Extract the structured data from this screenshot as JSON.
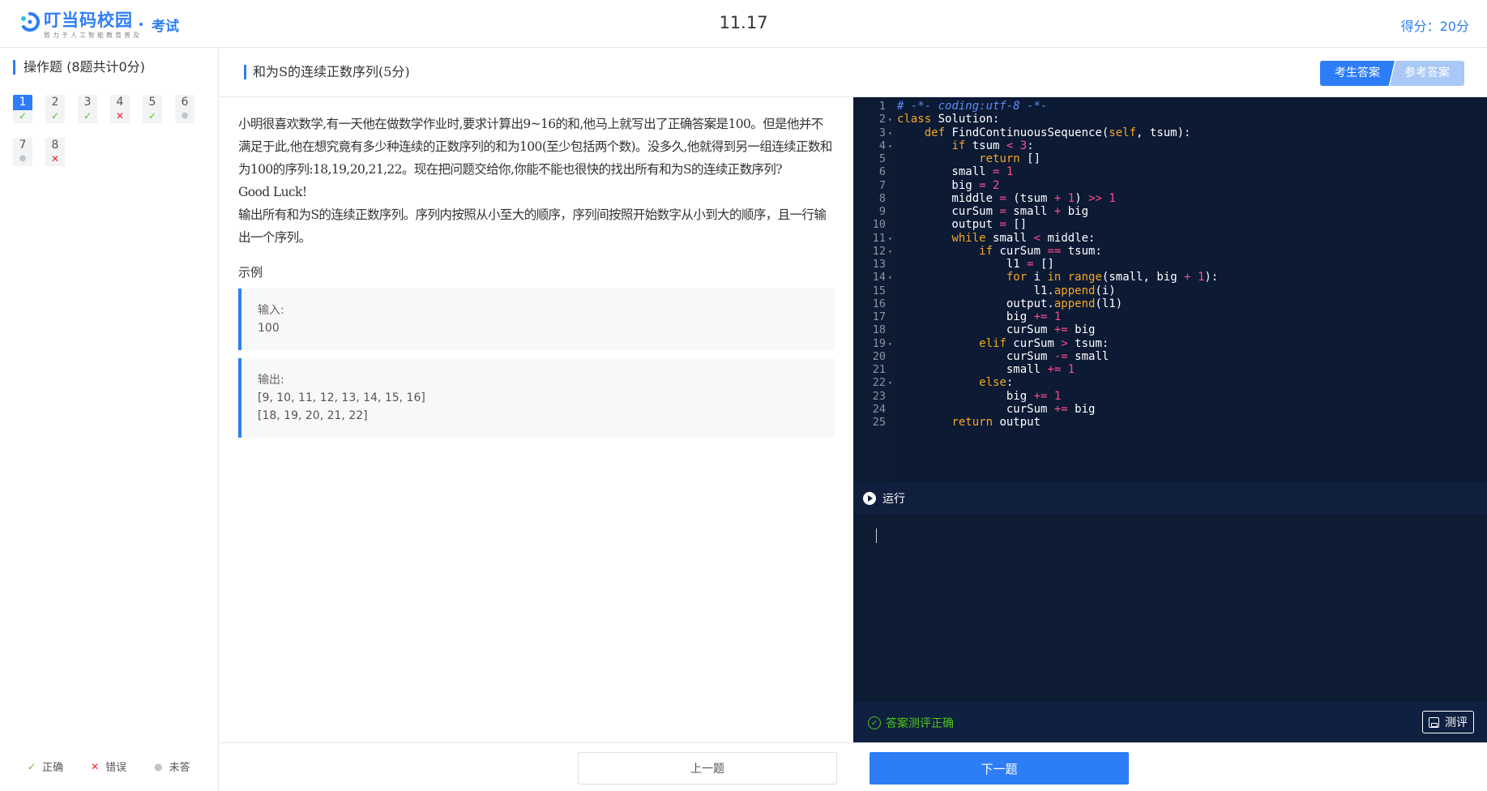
{
  "header": {
    "logo_name": "叮当码校园",
    "logo_slogan": "致力于人工智能教育普及",
    "exam_label": "考试",
    "exam_title": "11.17",
    "score_text": "得分：20分"
  },
  "sidebar": {
    "section_title": "操作题 (8题共计0分)",
    "questions": [
      {
        "num": "1",
        "status": "correct",
        "active": true
      },
      {
        "num": "2",
        "status": "correct",
        "active": false
      },
      {
        "num": "3",
        "status": "correct",
        "active": false
      },
      {
        "num": "4",
        "status": "wrong",
        "active": false
      },
      {
        "num": "5",
        "status": "correct",
        "active": false
      },
      {
        "num": "6",
        "status": "unanswered",
        "active": false
      },
      {
        "num": "7",
        "status": "unanswered",
        "active": false
      },
      {
        "num": "8",
        "status": "wrong",
        "active": false
      }
    ],
    "legend": {
      "correct": "正确",
      "wrong": "错误",
      "unanswered": "未答"
    }
  },
  "question": {
    "title": "和为S的连续正数序列(5分)",
    "tab_student": "考生答案",
    "tab_reference": "参考答案",
    "description": [
      "小明很喜欢数学,有一天他在做数学作业时,要求计算出9~16的和,他马上就写出了正确答案是100。但是他并不满足于此,他在想究竟有多少种连续的正数序列的和为100(至少包括两个数)。没多久,他就得到另一组连续正数和为100的序列:18,19,20,21,22。现在把问题交给你,你能不能也很快的找出所有和为S的连续正数序列?",
      "Good Luck!",
      "输出所有和为S的连续正数序列。序列内按照从小至大的顺序，序列间按照开始数字从小到大的顺序，且一行输出一个序列。"
    ],
    "example_label": "示例",
    "example_input_label": "输入:",
    "example_input": "100",
    "example_output_label": "输出:",
    "example_output": [
      "[9, 10, 11, 12, 13, 14, 15, 16]",
      "[18, 19, 20, 21, 22]"
    ]
  },
  "editor": {
    "lines": [
      {
        "n": "1",
        "fold": false
      },
      {
        "n": "2",
        "fold": true
      },
      {
        "n": "3",
        "fold": true
      },
      {
        "n": "4",
        "fold": true
      },
      {
        "n": "5",
        "fold": false
      },
      {
        "n": "6",
        "fold": false
      },
      {
        "n": "7",
        "fold": false
      },
      {
        "n": "8",
        "fold": false
      },
      {
        "n": "9",
        "fold": false
      },
      {
        "n": "10",
        "fold": false
      },
      {
        "n": "11",
        "fold": true
      },
      {
        "n": "12",
        "fold": true
      },
      {
        "n": "13",
        "fold": false
      },
      {
        "n": "14",
        "fold": true
      },
      {
        "n": "15",
        "fold": false
      },
      {
        "n": "16",
        "fold": false
      },
      {
        "n": "17",
        "fold": false
      },
      {
        "n": "18",
        "fold": false
      },
      {
        "n": "19",
        "fold": true
      },
      {
        "n": "20",
        "fold": false
      },
      {
        "n": "21",
        "fold": false
      },
      {
        "n": "22",
        "fold": true
      },
      {
        "n": "23",
        "fold": false
      },
      {
        "n": "24",
        "fold": false
      },
      {
        "n": "25",
        "fold": false
      }
    ],
    "code": [
      [
        [
          "c-comment",
          "# -*- coding:utf-8 -*-"
        ]
      ],
      [
        [
          "c-kw",
          "class"
        ],
        [
          "c-txt",
          " Solution:"
        ]
      ],
      [
        [
          "c-txt",
          "    "
        ],
        [
          "c-kw",
          "def"
        ],
        [
          "c-fn",
          " FindContinuousSequence("
        ],
        [
          "c-self",
          "self"
        ],
        [
          "c-txt",
          ", tsum):"
        ]
      ],
      [
        [
          "c-txt",
          "        "
        ],
        [
          "c-kw",
          "if"
        ],
        [
          "c-txt",
          " tsum "
        ],
        [
          "c-op",
          "<"
        ],
        [
          "c-txt",
          " "
        ],
        [
          "c-num",
          "3"
        ],
        [
          "c-txt",
          ":"
        ]
      ],
      [
        [
          "c-txt",
          "            "
        ],
        [
          "c-kw",
          "return"
        ],
        [
          "c-txt",
          " []"
        ]
      ],
      [
        [
          "c-txt",
          "        small "
        ],
        [
          "c-op",
          "="
        ],
        [
          "c-txt",
          " "
        ],
        [
          "c-num",
          "1"
        ]
      ],
      [
        [
          "c-txt",
          "        big "
        ],
        [
          "c-op",
          "="
        ],
        [
          "c-txt",
          " "
        ],
        [
          "c-num",
          "2"
        ]
      ],
      [
        [
          "c-txt",
          "        middle "
        ],
        [
          "c-op",
          "="
        ],
        [
          "c-txt",
          " (tsum "
        ],
        [
          "c-op",
          "+"
        ],
        [
          "c-txt",
          " "
        ],
        [
          "c-num",
          "1"
        ],
        [
          "c-txt",
          ") "
        ],
        [
          "c-op",
          ">>"
        ],
        [
          "c-txt",
          " "
        ],
        [
          "c-num",
          "1"
        ]
      ],
      [
        [
          "c-txt",
          "        curSum "
        ],
        [
          "c-op",
          "="
        ],
        [
          "c-txt",
          " small "
        ],
        [
          "c-op",
          "+"
        ],
        [
          "c-txt",
          " big"
        ]
      ],
      [
        [
          "c-txt",
          "        output "
        ],
        [
          "c-op",
          "="
        ],
        [
          "c-txt",
          " []"
        ]
      ],
      [
        [
          "c-txt",
          "        "
        ],
        [
          "c-kw",
          "while"
        ],
        [
          "c-txt",
          " small "
        ],
        [
          "c-op",
          "<"
        ],
        [
          "c-txt",
          " middle:"
        ]
      ],
      [
        [
          "c-txt",
          "            "
        ],
        [
          "c-kw",
          "if"
        ],
        [
          "c-txt",
          " curSum "
        ],
        [
          "c-op",
          "=="
        ],
        [
          "c-txt",
          " tsum:"
        ]
      ],
      [
        [
          "c-txt",
          "                l1 "
        ],
        [
          "c-op",
          "="
        ],
        [
          "c-txt",
          " []"
        ]
      ],
      [
        [
          "c-txt",
          "                "
        ],
        [
          "c-kw",
          "for"
        ],
        [
          "c-txt",
          " i "
        ],
        [
          "c-kw",
          "in"
        ],
        [
          "c-txt",
          " "
        ],
        [
          "c-kw",
          "range"
        ],
        [
          "c-txt",
          "(small, big "
        ],
        [
          "c-op",
          "+"
        ],
        [
          "c-txt",
          " "
        ],
        [
          "c-num",
          "1"
        ],
        [
          "c-txt",
          "):"
        ]
      ],
      [
        [
          "c-txt",
          "                    l1."
        ],
        [
          "c-kw",
          "append"
        ],
        [
          "c-txt",
          "(i)"
        ]
      ],
      [
        [
          "c-txt",
          "                output."
        ],
        [
          "c-kw",
          "append"
        ],
        [
          "c-txt",
          "(l1)"
        ]
      ],
      [
        [
          "c-txt",
          "                big "
        ],
        [
          "c-op",
          "+="
        ],
        [
          "c-txt",
          " "
        ],
        [
          "c-num",
          "1"
        ]
      ],
      [
        [
          "c-txt",
          "                curSum "
        ],
        [
          "c-op",
          "+="
        ],
        [
          "c-txt",
          " big"
        ]
      ],
      [
        [
          "c-txt",
          "            "
        ],
        [
          "c-kw",
          "elif"
        ],
        [
          "c-txt",
          " curSum "
        ],
        [
          "c-op",
          ">"
        ],
        [
          "c-txt",
          " tsum:"
        ]
      ],
      [
        [
          "c-txt",
          "                curSum "
        ],
        [
          "c-op",
          "-="
        ],
        [
          "c-txt",
          " small"
        ]
      ],
      [
        [
          "c-txt",
          "                small "
        ],
        [
          "c-op",
          "+="
        ],
        [
          "c-txt",
          " "
        ],
        [
          "c-num",
          "1"
        ]
      ],
      [
        [
          "c-txt",
          "            "
        ],
        [
          "c-kw",
          "else"
        ],
        [
          "c-txt",
          ":"
        ]
      ],
      [
        [
          "c-txt",
          "                big "
        ],
        [
          "c-op",
          "+="
        ],
        [
          "c-txt",
          " "
        ],
        [
          "c-num",
          "1"
        ]
      ],
      [
        [
          "c-txt",
          "                curSum "
        ],
        [
          "c-op",
          "+="
        ],
        [
          "c-txt",
          " big"
        ]
      ],
      [
        [
          "c-txt",
          "        "
        ],
        [
          "c-kw",
          "return"
        ],
        [
          "c-txt",
          " output"
        ]
      ]
    ]
  },
  "run": {
    "label": "运行"
  },
  "result": {
    "status_text": "答案测评正确",
    "test_label": "测评"
  },
  "footer": {
    "prev_label": "上一题",
    "next_label": "下一题"
  }
}
